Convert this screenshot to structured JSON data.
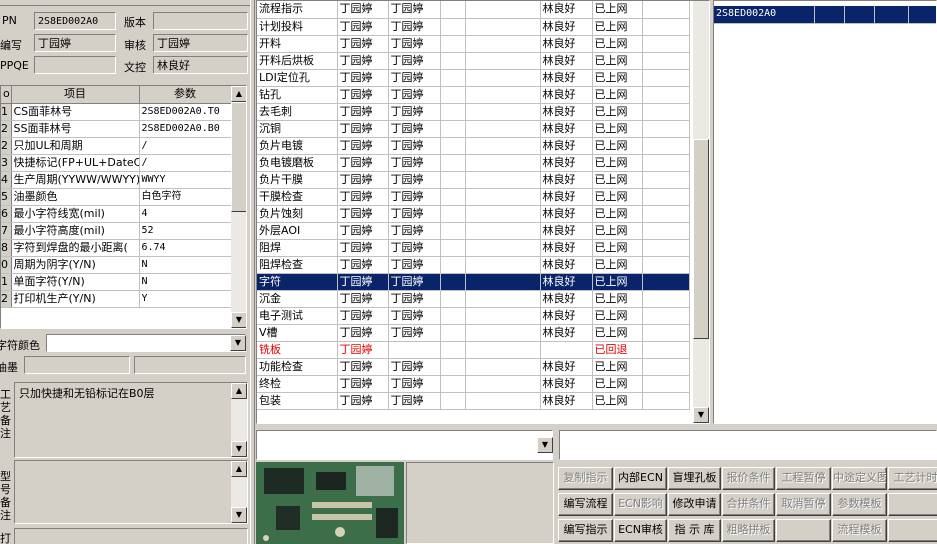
{
  "top_fields": {
    "pn_label": "PN",
    "pn_value": "2S8ED002A0",
    "version_label": "版本",
    "version_value": "",
    "author_label": "编写",
    "author_value": "丁园婷",
    "review_label": "审核",
    "review_value": "丁园婷",
    "ppqe_label": "PPQE",
    "ppqe_value": "",
    "doc_control_label": "文控",
    "doc_control_value": "林良好"
  },
  "params_table": {
    "headers": [
      "o",
      "项目",
      "参数"
    ],
    "rows": [
      {
        "no": "1",
        "item": "CS面菲林号",
        "value": "2S8ED002A0.T0"
      },
      {
        "no": "2",
        "item": "SS面菲林号",
        "value": "2S8ED002A0.B0"
      },
      {
        "no": "2",
        "item": "只加UL和周期",
        "value": "/"
      },
      {
        "no": "3",
        "item": "快捷标记(FP+UL+DateCo",
        "value": "/"
      },
      {
        "no": "4",
        "item": "生产周期(YYWW/WWYY)",
        "value": "WWYY"
      },
      {
        "no": "5",
        "item": "油墨颜色",
        "value": "白色字符"
      },
      {
        "no": "6",
        "item": "最小字符线宽(mil)",
        "value": "4"
      },
      {
        "no": "7",
        "item": "最小字符高度(mil)",
        "value": "52"
      },
      {
        "no": "8",
        "item": "字符到焊盘的最小距离(",
        "value": "6.74"
      },
      {
        "no": "0",
        "item": "周期为阴字(Y/N)",
        "value": "N"
      },
      {
        "no": "1",
        "item": "单面字符(Y/N)",
        "value": "N"
      },
      {
        "no": "2",
        "item": "打印机生产(Y/N)",
        "value": "Y"
      }
    ]
  },
  "char_color": {
    "label": "字符颜色",
    "value": ""
  },
  "ink": {
    "label": "油墨",
    "value1": "",
    "value2": ""
  },
  "process_note": {
    "label": "工艺备注",
    "value": "只加快捷和无铅标记在B0层"
  },
  "model_note": {
    "label": "型号备注",
    "value": ""
  },
  "bottom_label": "打",
  "process_table": {
    "rows": [
      {
        "name": "流程指示",
        "c1": "丁园婷",
        "c2": "丁园婷",
        "c5": "林良好",
        "c6": "已上网",
        "status": "normal"
      },
      {
        "name": "计划投料",
        "c1": "丁园婷",
        "c2": "丁园婷",
        "c5": "林良好",
        "c6": "已上网",
        "status": "normal"
      },
      {
        "name": "开料",
        "c1": "丁园婷",
        "c2": "丁园婷",
        "c5": "林良好",
        "c6": "已上网",
        "status": "normal"
      },
      {
        "name": "开料后烘板",
        "c1": "丁园婷",
        "c2": "丁园婷",
        "c5": "林良好",
        "c6": "已上网",
        "status": "normal"
      },
      {
        "name": "LDI定位孔",
        "c1": "丁园婷",
        "c2": "丁园婷",
        "c5": "林良好",
        "c6": "已上网",
        "status": "normal"
      },
      {
        "name": "钻孔",
        "c1": "丁园婷",
        "c2": "丁园婷",
        "c5": "林良好",
        "c6": "已上网",
        "status": "normal"
      },
      {
        "name": "去毛刺",
        "c1": "丁园婷",
        "c2": "丁园婷",
        "c5": "林良好",
        "c6": "已上网",
        "status": "normal"
      },
      {
        "name": "沉铜",
        "c1": "丁园婷",
        "c2": "丁园婷",
        "c5": "林良好",
        "c6": "已上网",
        "status": "normal"
      },
      {
        "name": "负片电镀",
        "c1": "丁园婷",
        "c2": "丁园婷",
        "c5": "林良好",
        "c6": "已上网",
        "status": "normal"
      },
      {
        "name": "负电镀磨板",
        "c1": "丁园婷",
        "c2": "丁园婷",
        "c5": "林良好",
        "c6": "已上网",
        "status": "normal"
      },
      {
        "name": "负片干膜",
        "c1": "丁园婷",
        "c2": "丁园婷",
        "c5": "林良好",
        "c6": "已上网",
        "status": "normal"
      },
      {
        "name": "干膜检查",
        "c1": "丁园婷",
        "c2": "丁园婷",
        "c5": "林良好",
        "c6": "已上网",
        "status": "normal"
      },
      {
        "name": "负片蚀刻",
        "c1": "丁园婷",
        "c2": "丁园婷",
        "c5": "林良好",
        "c6": "已上网",
        "status": "normal"
      },
      {
        "name": "外层AOI",
        "c1": "丁园婷",
        "c2": "丁园婷",
        "c5": "林良好",
        "c6": "已上网",
        "status": "normal"
      },
      {
        "name": "阻焊",
        "c1": "丁园婷",
        "c2": "丁园婷",
        "c5": "林良好",
        "c6": "已上网",
        "status": "normal"
      },
      {
        "name": "阻焊检查",
        "c1": "丁园婷",
        "c2": "丁园婷",
        "c5": "林良好",
        "c6": "已上网",
        "status": "normal"
      },
      {
        "name": "字符",
        "c1": "丁园婷",
        "c2": "丁园婷",
        "c5": "林良好",
        "c6": "已上网",
        "status": "selected"
      },
      {
        "name": "沉金",
        "c1": "丁园婷",
        "c2": "丁园婷",
        "c5": "林良好",
        "c6": "已上网",
        "status": "normal"
      },
      {
        "name": "电子测试",
        "c1": "丁园婷",
        "c2": "丁园婷",
        "c5": "林良好",
        "c6": "已上网",
        "status": "normal"
      },
      {
        "name": "V槽",
        "c1": "丁园婷",
        "c2": "丁园婷",
        "c5": "林良好",
        "c6": "已上网",
        "status": "normal"
      },
      {
        "name": "铣板",
        "c1": "丁园婷",
        "c2": "",
        "c5": "",
        "c6": "已回退",
        "status": "returned"
      },
      {
        "name": "功能检查",
        "c1": "丁园婷",
        "c2": "丁园婷",
        "c5": "林良好",
        "c6": "已上网",
        "status": "normal"
      },
      {
        "name": "终检",
        "c1": "丁园婷",
        "c2": "丁园婷",
        "c5": "林良好",
        "c6": "已上网",
        "status": "normal"
      },
      {
        "name": "包装",
        "c1": "丁园婷",
        "c2": "丁园婷",
        "c5": "林良好",
        "c6": "已上网",
        "status": "normal"
      }
    ]
  },
  "right_list": {
    "items": [
      "2S8ED002A0"
    ]
  },
  "buttons": {
    "row1": [
      {
        "label": "复制指示",
        "enabled": false
      },
      {
        "label": "内部ECN",
        "enabled": true
      },
      {
        "label": "盲埋孔板",
        "enabled": true
      },
      {
        "label": "报价条件",
        "enabled": false
      },
      {
        "label": "工程暂停",
        "enabled": false
      },
      {
        "label": "中途定义图",
        "enabled": false
      },
      {
        "label": "工艺计时",
        "enabled": false
      }
    ],
    "row2": [
      {
        "label": "编写流程",
        "enabled": true
      },
      {
        "label": "ECN影响",
        "enabled": false
      },
      {
        "label": "修改申请",
        "enabled": true
      },
      {
        "label": "合拼条件",
        "enabled": false
      },
      {
        "label": "取消暂停",
        "enabled": false
      },
      {
        "label": "参数模板",
        "enabled": false
      },
      {
        "label": "",
        "enabled": false
      }
    ],
    "row3": [
      {
        "label": "编写指示",
        "enabled": true
      },
      {
        "label": "ECN审核",
        "enabled": true
      },
      {
        "label": "指 示 库",
        "enabled": true
      },
      {
        "label": "粗略拼板",
        "enabled": false
      },
      {
        "label": "",
        "enabled": false
      },
      {
        "label": "流程模板",
        "enabled": false
      },
      {
        "label": "",
        "enabled": false
      }
    ]
  },
  "colors": {
    "selection": "#0a246a",
    "returned": "#e00000",
    "face": "#d4d0c8"
  }
}
